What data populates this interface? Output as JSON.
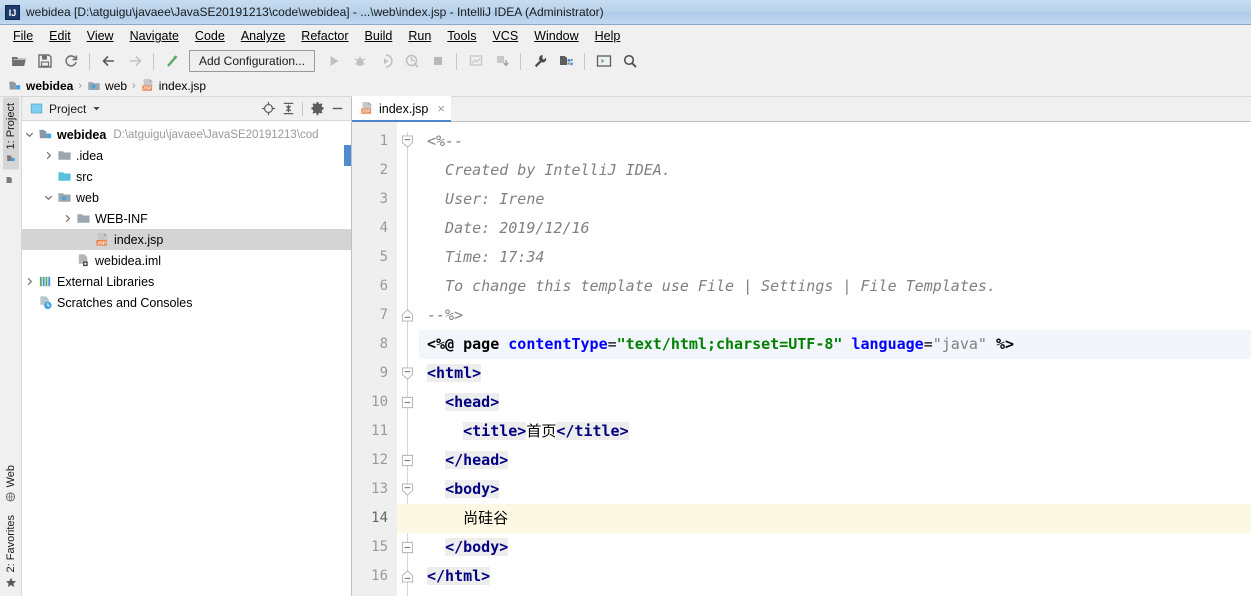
{
  "window": {
    "title": "webidea [D:\\atguigu\\javaee\\JavaSE20191213\\code\\webidea] - ...\\web\\index.jsp - IntelliJ IDEA (Administrator)",
    "logo_text": "IJ"
  },
  "menu": {
    "items": [
      {
        "label": "File"
      },
      {
        "label": "Edit"
      },
      {
        "label": "View"
      },
      {
        "label": "Navigate"
      },
      {
        "label": "Code"
      },
      {
        "label": "Analyze"
      },
      {
        "label": "Refactor"
      },
      {
        "label": "Build"
      },
      {
        "label": "Run"
      },
      {
        "label": "Tools"
      },
      {
        "label": "VCS"
      },
      {
        "label": "Window"
      },
      {
        "label": "Help"
      }
    ]
  },
  "toolbar": {
    "run_configuration": "Add Configuration...",
    "buttons": [
      {
        "name": "open-folder-icon"
      },
      {
        "name": "save-all-icon"
      },
      {
        "name": "sync-icon"
      },
      {
        "name": "back-arrow-icon"
      },
      {
        "name": "forward-arrow-icon"
      },
      {
        "name": "update-project-icon"
      },
      {
        "name": "run-icon"
      },
      {
        "name": "debug-icon"
      },
      {
        "name": "run-with-coverage-icon"
      },
      {
        "name": "profile-icon"
      },
      {
        "name": "stop-icon"
      },
      {
        "name": "commit-icon"
      },
      {
        "name": "update-icon"
      },
      {
        "name": "settings-wrench-icon"
      },
      {
        "name": "project-structure-icon"
      },
      {
        "name": "terminal-icon"
      },
      {
        "name": "search-everywhere-icon"
      }
    ]
  },
  "breadcrumb": {
    "items": [
      {
        "label": "webidea",
        "icon": "module-icon",
        "bold": true
      },
      {
        "label": "web",
        "icon": "web-folder-icon",
        "bold": false
      },
      {
        "label": "index.jsp",
        "icon": "jsp-file-icon",
        "bold": false
      }
    ],
    "separator": "›"
  },
  "left_strip": {
    "top": [
      {
        "label": "1: Project",
        "icon": "project-icon",
        "active": true
      },
      {
        "label": "",
        "icon": "structure-icon",
        "active": false
      }
    ],
    "bottom": [
      {
        "label": "Web",
        "icon": "web-icon",
        "active": false
      },
      {
        "label": "2: Favorites",
        "icon": "star-icon",
        "active": false
      }
    ]
  },
  "project_panel": {
    "title": "Project",
    "header_buttons": [
      {
        "name": "locate-target-icon"
      },
      {
        "name": "collapse-all-icon"
      },
      {
        "name": "settings-gear-icon"
      },
      {
        "name": "hide-panel-icon"
      }
    ],
    "tree": [
      {
        "label": "webidea",
        "path": "D:\\atguigu\\javaee\\JavaSE20191213\\cod",
        "indent": 0,
        "arrow": "down",
        "icon": "module-icon",
        "bold": true,
        "selected": false
      },
      {
        "label": ".idea",
        "path": "",
        "indent": 1,
        "arrow": "right",
        "icon": "folder-icon",
        "bold": false,
        "selected": false
      },
      {
        "label": "src",
        "path": "",
        "indent": 1,
        "arrow": "none",
        "icon": "source-folder-icon",
        "bold": false,
        "selected": false
      },
      {
        "label": "web",
        "path": "",
        "indent": 1,
        "arrow": "down",
        "icon": "web-folder-icon",
        "bold": false,
        "selected": false
      },
      {
        "label": "WEB-INF",
        "path": "",
        "indent": 2,
        "arrow": "right",
        "icon": "folder-icon",
        "bold": false,
        "selected": false
      },
      {
        "label": "index.jsp",
        "path": "",
        "indent": 3,
        "arrow": "none",
        "icon": "jsp-file-icon",
        "bold": false,
        "selected": true
      },
      {
        "label": "webidea.iml",
        "path": "",
        "indent": 2,
        "arrow": "none",
        "icon": "iml-file-icon",
        "bold": false,
        "selected": false
      },
      {
        "label": "External Libraries",
        "path": "",
        "indent": 0,
        "arrow": "right",
        "icon": "libraries-icon",
        "bold": false,
        "selected": false
      },
      {
        "label": "Scratches and Consoles",
        "path": "",
        "indent": 0,
        "arrow": "none",
        "icon": "scratches-icon",
        "bold": false,
        "selected": false
      }
    ]
  },
  "editor": {
    "tabs": [
      {
        "label": "index.jsp",
        "icon": "jsp-file-icon",
        "active": true,
        "close": "×"
      }
    ],
    "current_line": 14,
    "lines": [
      {
        "n": 1,
        "fold": "start"
      },
      {
        "n": 2,
        "fold": "none"
      },
      {
        "n": 3,
        "fold": "none"
      },
      {
        "n": 4,
        "fold": "none"
      },
      {
        "n": 5,
        "fold": "none"
      },
      {
        "n": 6,
        "fold": "none"
      },
      {
        "n": 7,
        "fold": "end"
      },
      {
        "n": 8,
        "fold": "none"
      },
      {
        "n": 9,
        "fold": "start"
      },
      {
        "n": 10,
        "fold": "startmid"
      },
      {
        "n": 11,
        "fold": "none"
      },
      {
        "n": 12,
        "fold": "endmid"
      },
      {
        "n": 13,
        "fold": "startmid"
      },
      {
        "n": 14,
        "fold": "none"
      },
      {
        "n": 15,
        "fold": "endmid"
      },
      {
        "n": 16,
        "fold": "end"
      }
    ],
    "code_text": [
      "<%--",
      "  Created by IntelliJ IDEA.",
      "  User: Irene",
      "  Date: 2019/12/16",
      "  Time: 17:34",
      "  To change this template use File | Settings | File Templates.",
      "--%>",
      "<%@ page contentType=\"text/html;charset=UTF-8\" language=\"java\" %>",
      "<html>",
      "  <head>",
      "    <title>首页</title>",
      "  </head>",
      "  <body>",
      "    尚硅谷",
      "  </body>",
      "</html>"
    ]
  },
  "colors": {
    "title_gradient_top": "#c8dcf0",
    "title_gradient_bottom": "#c3d9f1",
    "chrome": "#f0f0f0",
    "selection": "#d4d4d4",
    "tab_underline": "#4a86c8",
    "current_line": "#fdf8e3",
    "comment": "#808080",
    "tag": "#000080",
    "attribute": "#0000ff",
    "string": "#008000",
    "jsp_bg": "#f2f5fb",
    "scrollbar": "#4f8bd0"
  }
}
